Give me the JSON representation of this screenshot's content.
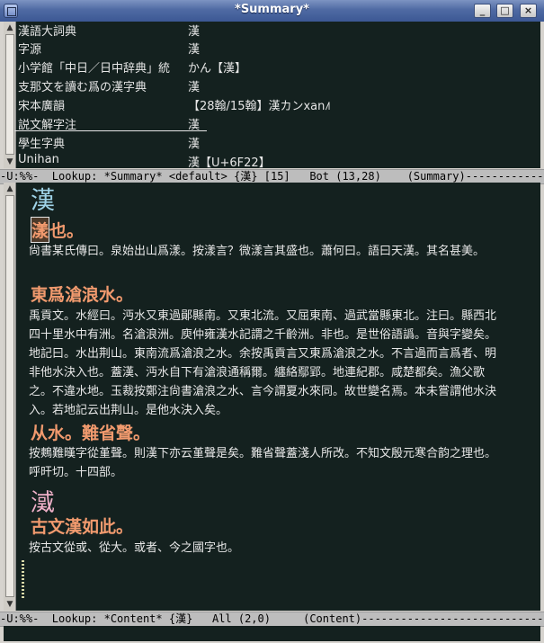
{
  "window": {
    "title": "*Summary*",
    "buttons": {
      "minimize": "_",
      "maximize": "□",
      "close": "×"
    }
  },
  "summary": {
    "rows": [
      {
        "key": "漢語大詞典",
        "value": "漢"
      },
      {
        "key": "字源",
        "value": "漢"
      },
      {
        "key": "小学館「中日／日中辞典」統",
        "value": "かん【漢】"
      },
      {
        "key": "支那文を讀む爲の漢字典",
        "value": "漢"
      },
      {
        "key": "宋本廣韻",
        "value": "【28翰/15翰】漢カンxan˩˥"
      },
      {
        "key": "説文解字注",
        "value": "漢"
      },
      {
        "key": "學生字典",
        "value": "漢"
      },
      {
        "key": "Unihan",
        "value": "漢【U+6F22】"
      }
    ]
  },
  "modeline_top": "-U:%%-  Lookup: *Summary* <default> {漢} [15]   Bot (13,28)    (Summary)------------",
  "content": {
    "headword": "漢",
    "s1_head_first": "漾",
    "s1_head_rest": "也。",
    "s1_text": "尙書某氏傳曰。泉始出山爲漾。按漾言？微漾言其盛也。蕭何曰。語曰天漢。其名甚美。",
    "s2_head": "東爲滄浪水。",
    "s2_text": "禹貢文。水經曰。沔水又東過鄖縣南。又東北流。又屈東南、過武當縣東北。注曰。縣西北四十里水中有洲。名滄浪洲。庾仲雍漢水記謂之千齡洲。非也。是世俗語譌。音與字變矣。地記曰。水出荆山。東南流爲滄浪之水。余按禹貢言又東爲滄浪之水。不言過而言爲者、明非他水決入也。蓋漢、沔水自下有滄浪通稱爾。纏絡鄢郢。地連紀郡。咸楚都矣。漁父歌之。不違水地。玉裁按鄭注尙書滄浪之水、言今謂夏水來同。故世變名焉。本未嘗謂他水決入。若地記云出荆山。是他水決入矣。",
    "s3_head": "从水。難省聲。",
    "s3_text": "按鷞難暵字從堇聲。則漢下亦云堇聲是矣。難省聲蓋淺人所改。不知文殷元寒合韵之理也。呼旰切。十四部。",
    "s4_head": "㵄",
    "s5_head": "古文漢如此。",
    "s5_text": "按古文從或、從大。或者、今之國字也。"
  },
  "modeline_bottom": "-U:%%-  Lookup: *Content* {漢}   All (2,0)     (Content)-----------------------------"
}
